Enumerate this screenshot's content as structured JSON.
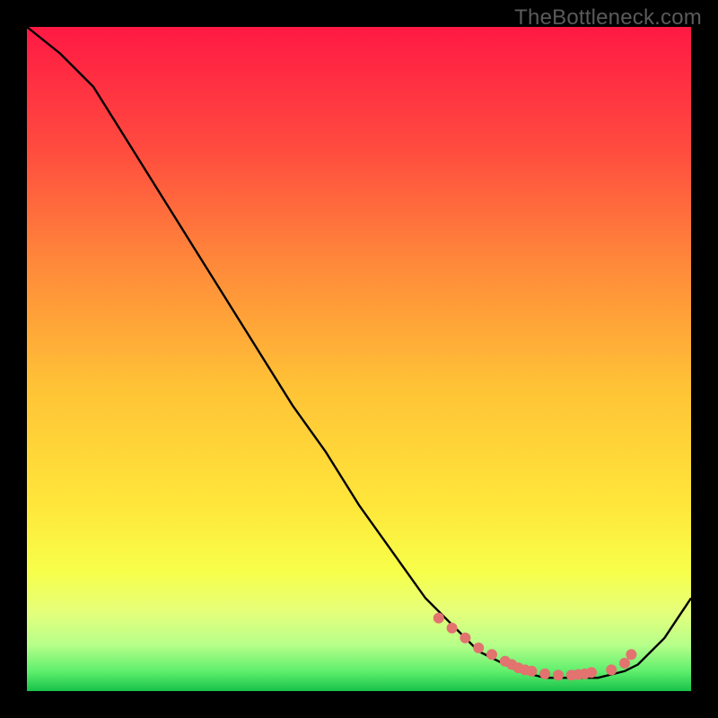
{
  "watermark": "TheBottleneck.com",
  "chart_data": {
    "type": "line",
    "title": "",
    "xlabel": "",
    "ylabel": "",
    "xlim": [
      0,
      100
    ],
    "ylim": [
      0,
      100
    ],
    "series": [
      {
        "name": "curve",
        "x": [
          0,
          5,
          10,
          15,
          20,
          25,
          30,
          35,
          40,
          45,
          50,
          55,
          60,
          62,
          65,
          68,
          70,
          72,
          74,
          76,
          78,
          80,
          82,
          84,
          86,
          88,
          90,
          92,
          94,
          96,
          98,
          100
        ],
        "y": [
          100,
          96,
          91,
          83,
          75,
          67,
          59,
          51,
          43,
          36,
          28,
          21,
          14,
          12,
          9,
          6,
          5,
          4,
          3,
          2.5,
          2,
          2,
          2,
          2,
          2,
          2.5,
          3,
          4,
          6,
          8,
          11,
          14
        ]
      },
      {
        "name": "markers",
        "x": [
          62,
          64,
          66,
          68,
          70,
          72,
          73,
          74,
          75,
          76,
          78,
          80,
          82,
          83,
          84,
          85,
          88,
          90,
          91
        ],
        "y": [
          11,
          9.5,
          8,
          6.5,
          5.5,
          4.5,
          4,
          3.5,
          3.2,
          3,
          2.6,
          2.4,
          2.4,
          2.5,
          2.6,
          2.8,
          3.2,
          4.2,
          5.5
        ]
      }
    ],
    "gradient_stops": [
      {
        "offset": 0.0,
        "color": "#ff1944"
      },
      {
        "offset": 0.18,
        "color": "#ff4a3f"
      },
      {
        "offset": 0.36,
        "color": "#ff8a3a"
      },
      {
        "offset": 0.54,
        "color": "#ffc236"
      },
      {
        "offset": 0.72,
        "color": "#ffe63a"
      },
      {
        "offset": 0.82,
        "color": "#f7ff4a"
      },
      {
        "offset": 0.88,
        "color": "#e6ff7a"
      },
      {
        "offset": 0.93,
        "color": "#b8ff8a"
      },
      {
        "offset": 0.97,
        "color": "#5fef6d"
      },
      {
        "offset": 1.0,
        "color": "#18c24a"
      }
    ],
    "marker_color": "#e2736f",
    "curve_color": "#000000"
  }
}
